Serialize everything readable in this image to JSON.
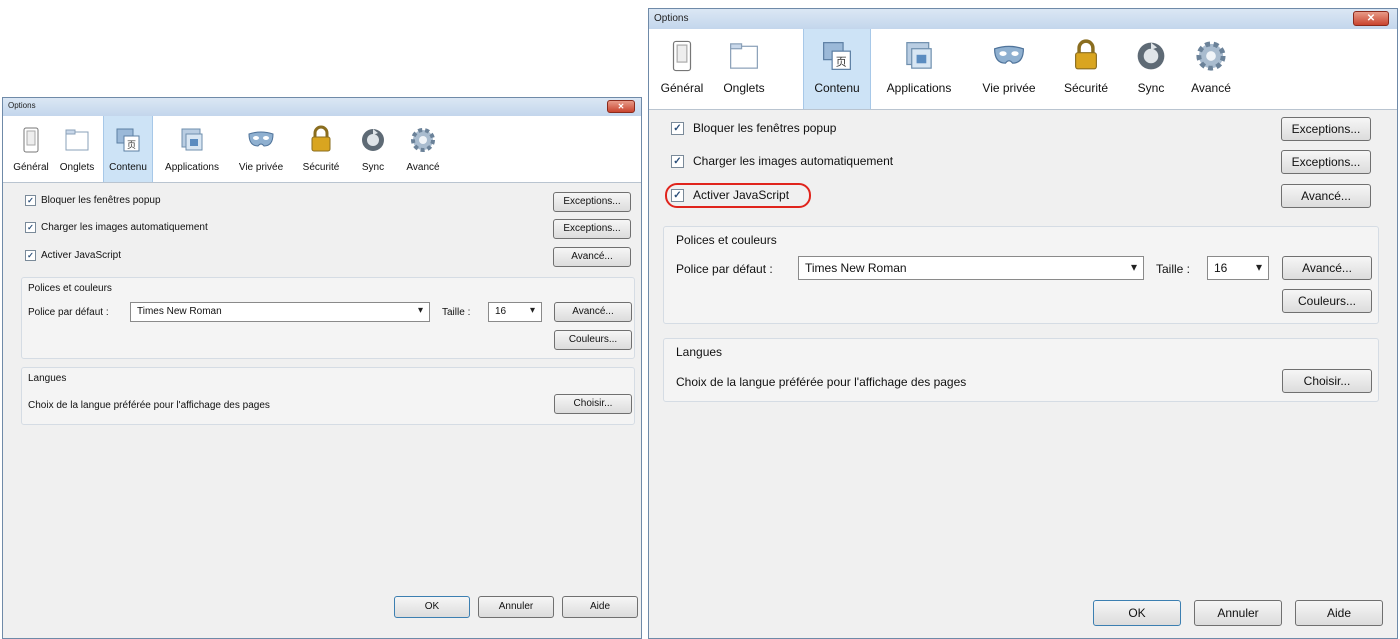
{
  "title": "Options",
  "close_glyph": "✕",
  "tabs": [
    {
      "label": "Général",
      "icon": "general-icon"
    },
    {
      "label": "Onglets",
      "icon": "tabs-icon"
    },
    {
      "label": "Contenu",
      "icon": "content-icon"
    },
    {
      "label": "Applications",
      "icon": "applications-icon"
    },
    {
      "label": "Vie privée",
      "icon": "privacy-mask-icon"
    },
    {
      "label": "Sécurité",
      "icon": "security-lock-icon"
    },
    {
      "label": "Sync",
      "icon": "sync-icon"
    },
    {
      "label": "Avancé",
      "icon": "gear-icon"
    }
  ],
  "selected_tab": "Contenu",
  "content": {
    "checks": [
      {
        "label": "Bloquer les fenêtres popup",
        "checked": true,
        "button": "Exceptions..."
      },
      {
        "label": "Charger les images automatiquement",
        "checked": true,
        "button": "Exceptions..."
      },
      {
        "label": "Activer JavaScript",
        "checked": true,
        "button": "Avancé..."
      }
    ],
    "check_mark": "✓",
    "fonts": {
      "group_title": "Polices et couleurs",
      "default_font_label": "Police par défaut :",
      "default_font_value": "Times New Roman",
      "size_label": "Taille :",
      "size_value": "16",
      "advanced_button": "Avancé...",
      "colors_button": "Couleurs..."
    },
    "languages": {
      "group_title": "Langues",
      "description": "Choix de la langue préférée pour l'affichage des pages",
      "choose_button": "Choisir..."
    }
  },
  "footer": {
    "ok": "OK",
    "cancel": "Annuler",
    "help": "Aide"
  },
  "dropdown_arrow": "▾",
  "highlight_color": "#e0241c"
}
